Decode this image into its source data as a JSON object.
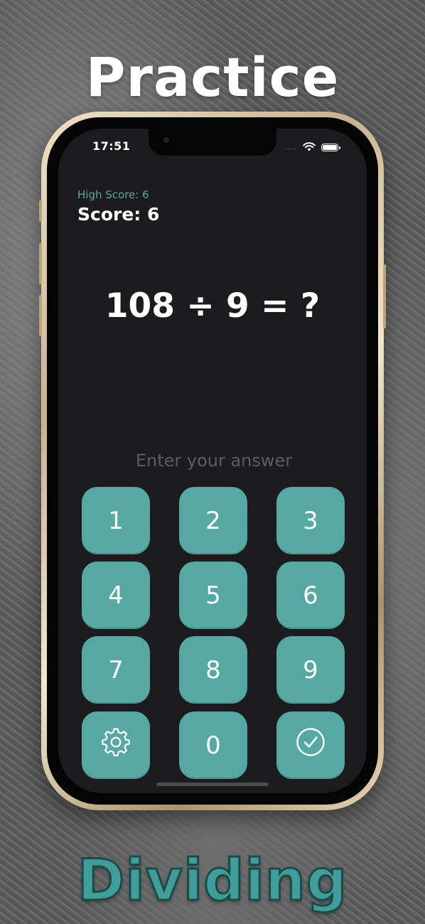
{
  "headline_top": "Practice",
  "headline_bottom": "Dividing",
  "status": {
    "time": "17:51",
    "dots": "....",
    "wifi_icon": "wifi-icon",
    "battery_icon": "battery-icon"
  },
  "game": {
    "high_score": "High Score: 6",
    "score": "Score: 6",
    "question": "108 ÷ 9 = ?",
    "answer_placeholder": "Enter your answer",
    "answer_value": ""
  },
  "keypad": {
    "keys": [
      "1",
      "2",
      "3",
      "4",
      "5",
      "6",
      "7",
      "8",
      "9"
    ],
    "settings_icon": "gear-icon",
    "zero": "0",
    "submit_icon": "checkmark-circle-icon"
  },
  "colors": {
    "accent": "#56a8a2",
    "screen_bg": "#1c1c1e",
    "high_score_text": "#5ba9a3",
    "headline_bottom": "#3f9e99",
    "headline_top": "#ffffff",
    "phone_frame": "#d9c8a3"
  }
}
